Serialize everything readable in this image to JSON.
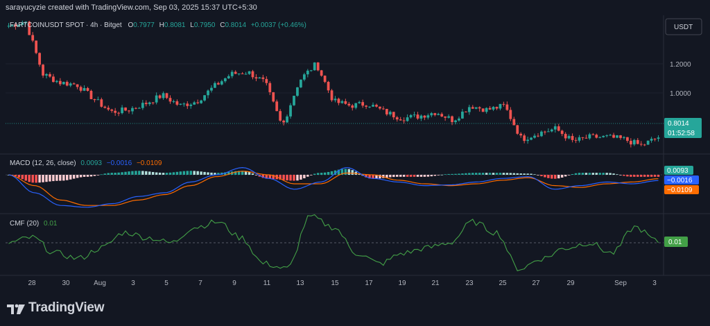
{
  "header": {
    "watermark": "sarayucyzie created with TradingView.com, Sep 03, 2025 15:37 UTC+5:30"
  },
  "footer": {
    "brand": "TradingView"
  },
  "colors": {
    "background": "#131722",
    "up": "#26a69a",
    "down": "#ef5350",
    "macd_line": "#2962ff",
    "signal_line": "#ff6d00",
    "cmf_line": "#43a047",
    "text": "#d1d4dc"
  },
  "legend": {
    "symbol": "FARTCOINUSDT SPOT · 4h · Bitget",
    "o_label": "O",
    "o": "0.7977",
    "h_label": "H",
    "h": "0.8081",
    "l_label": "L",
    "l": "0.7950",
    "c_label": "C",
    "c": "0.8014",
    "change": "+0.0037 (+0.46%)"
  },
  "currency_button": "USDT",
  "price_axis": {
    "ticks": [
      "1.2000",
      "1.0000"
    ],
    "tick_values": [
      1.2,
      1.0
    ],
    "last_price": "0.8014",
    "countdown": "01:52:58"
  },
  "macd_legend": {
    "name": "MACD (12, 26, close)",
    "v1": "0.0093",
    "v2": "−0.0016",
    "v3": "−0.0109"
  },
  "macd_axis": {
    "hist_label": "0.0093",
    "macd_label": "−0.0016",
    "signal_label": "−0.0109"
  },
  "cmf_legend": {
    "name": "CMF (20)",
    "v": "0.01"
  },
  "cmf_axis": {
    "label": "0.01"
  },
  "time_axis": {
    "labels": [
      "28",
      "30",
      "Aug",
      "3",
      "5",
      "7",
      "9",
      "11",
      "13",
      "15",
      "17",
      "19",
      "21",
      "23",
      "25",
      "27",
      "29",
      "Sep",
      "3"
    ]
  },
  "chart_data": [
    {
      "type": "candlestick",
      "title": "FARTCOINUSDT SPOT · 4h · Bitget",
      "ylim": [
        0.72,
        1.38
      ],
      "keypoints": [
        {
          "date": "Jul 27",
          "price": 1.33
        },
        {
          "date": "Jul 28",
          "price": 1.35
        },
        {
          "date": "Jul 29",
          "price": 1.1
        },
        {
          "date": "Jul 30",
          "price": 1.06
        },
        {
          "date": "Jul 31",
          "price": 1.05
        },
        {
          "date": "Aug 1",
          "price": 0.98
        },
        {
          "date": "Aug 2",
          "price": 0.92
        },
        {
          "date": "Aug 3",
          "price": 0.93
        },
        {
          "date": "Aug 4",
          "price": 0.96
        },
        {
          "date": "Aug 5",
          "price": 1.0
        },
        {
          "date": "Aug 6",
          "price": 0.95
        },
        {
          "date": "Aug 7",
          "price": 0.97
        },
        {
          "date": "Aug 8",
          "price": 1.04
        },
        {
          "date": "Aug 9",
          "price": 1.1
        },
        {
          "date": "Aug 10",
          "price": 1.11
        },
        {
          "date": "Aug 11",
          "price": 1.06
        },
        {
          "date": "Aug 12",
          "price": 0.85
        },
        {
          "date": "Aug 13",
          "price": 1.07
        },
        {
          "date": "Aug 14",
          "price": 1.15
        },
        {
          "date": "Aug 15",
          "price": 0.97
        },
        {
          "date": "Aug 16",
          "price": 0.95
        },
        {
          "date": "Aug 17",
          "price": 0.96
        },
        {
          "date": "Aug 18",
          "price": 0.92
        },
        {
          "date": "Aug 19",
          "price": 0.89
        },
        {
          "date": "Aug 20",
          "price": 0.9
        },
        {
          "date": "Aug 21",
          "price": 0.92
        },
        {
          "date": "Aug 22",
          "price": 0.88
        },
        {
          "date": "Aug 23",
          "price": 0.95
        },
        {
          "date": "Aug 24",
          "price": 0.93
        },
        {
          "date": "Aug 25",
          "price": 0.95
        },
        {
          "date": "Aug 26",
          "price": 0.79
        },
        {
          "date": "Aug 27",
          "price": 0.82
        },
        {
          "date": "Aug 28",
          "price": 0.84
        },
        {
          "date": "Aug 29",
          "price": 0.78
        },
        {
          "date": "Aug 30",
          "price": 0.8
        },
        {
          "date": "Aug 31",
          "price": 0.8
        },
        {
          "date": "Sep 1",
          "price": 0.79
        },
        {
          "date": "Sep 2",
          "price": 0.76
        },
        {
          "date": "Sep 3",
          "price": 0.8
        }
      ]
    },
    {
      "type": "line",
      "title": "MACD (12, 26, close)",
      "series": [
        {
          "name": "MACD",
          "keypoints": [
            0.0,
            -0.05,
            -0.085,
            -0.09,
            -0.08,
            -0.06,
            -0.05,
            -0.02,
            0.0,
            0.02,
            -0.01,
            -0.04,
            -0.02,
            0.02,
            -0.01,
            -0.02,
            -0.03,
            -0.028,
            -0.02,
            -0.01,
            -0.005,
            -0.04,
            -0.03,
            -0.02,
            -0.025,
            -0.016
          ]
        },
        {
          "name": "Signal",
          "keypoints": [
            0.0,
            -0.03,
            -0.07,
            -0.085,
            -0.085,
            -0.07,
            -0.055,
            -0.03,
            -0.005,
            0.01,
            0.0,
            -0.025,
            -0.025,
            0.005,
            0.0,
            -0.015,
            -0.025,
            -0.03,
            -0.025,
            -0.015,
            -0.008,
            -0.03,
            -0.035,
            -0.025,
            -0.02,
            -0.011
          ]
        }
      ]
    },
    {
      "type": "line",
      "title": "CMF (20)",
      "series": [
        {
          "name": "CMF",
          "keypoints": [
            0.0,
            0.05,
            -0.1,
            -0.15,
            -0.05,
            0.1,
            0.05,
            0.0,
            0.15,
            0.2,
            0.05,
            -0.2,
            -0.25,
            0.25,
            0.15,
            -0.1,
            -0.2,
            -0.1,
            -0.05,
            0.0,
            0.2,
            0.1,
            -0.25,
            -0.15,
            -0.05,
            0.0,
            -0.1,
            0.15,
            0.01
          ]
        }
      ]
    }
  ]
}
